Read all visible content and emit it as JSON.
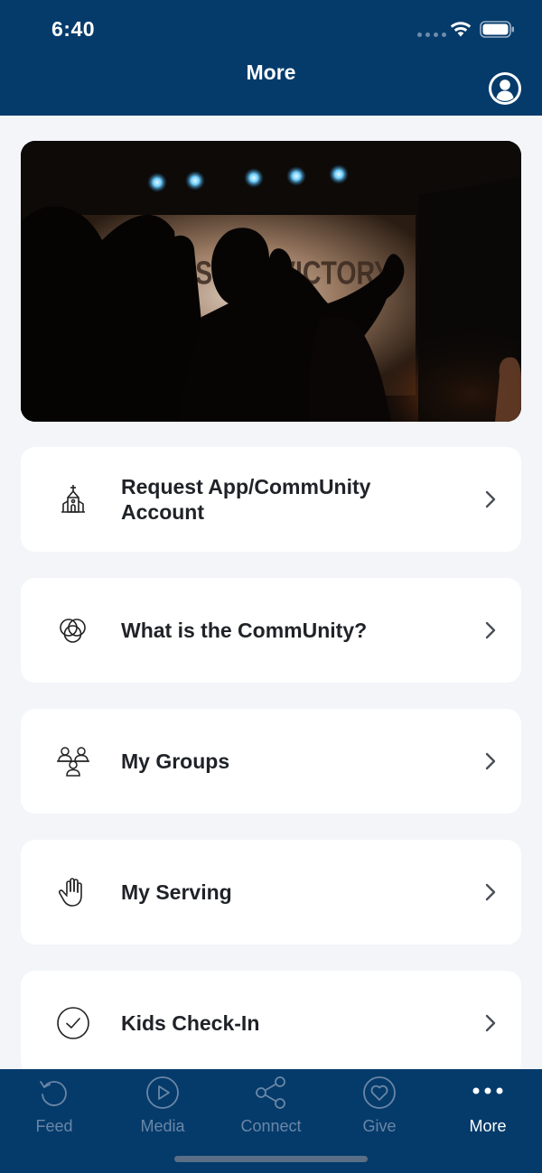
{
  "status_bar": {
    "time": "6:40"
  },
  "nav": {
    "title": "More"
  },
  "hero": {
    "screen_text": "YOURS IS THE VICTORY"
  },
  "menu": [
    {
      "label": "Request App/CommUnity Account",
      "icon": "church-icon"
    },
    {
      "label": "What is the CommUnity?",
      "icon": "overlapping-circles-icon"
    },
    {
      "label": "My Groups",
      "icon": "group-icon"
    },
    {
      "label": "My Serving",
      "icon": "hand-icon"
    },
    {
      "label": "Kids Check-In",
      "icon": "checkmark-circle-icon"
    }
  ],
  "tabs": [
    {
      "label": "Feed",
      "icon": "refresh-icon",
      "active": false
    },
    {
      "label": "Media",
      "icon": "play-icon",
      "active": false
    },
    {
      "label": "Connect",
      "icon": "share-icon",
      "active": false
    },
    {
      "label": "Give",
      "icon": "heart-icon",
      "active": false
    },
    {
      "label": "More",
      "icon": "more-dots-icon",
      "active": true
    }
  ],
  "colors": {
    "primary": "#053b6b",
    "background": "#f3f5f9",
    "tab_inactive": "#6a86a6",
    "tab_active": "#ffffff",
    "text": "#1f2227"
  }
}
